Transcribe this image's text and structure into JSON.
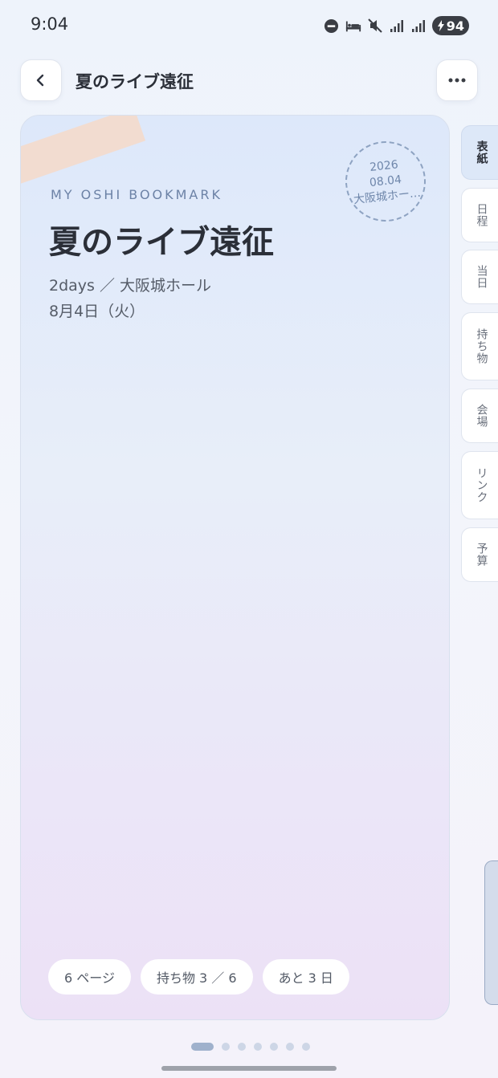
{
  "status_bar": {
    "time": "9:04",
    "battery": "94",
    "icons": [
      "do-not-disturb-icon",
      "bed-icon",
      "mute-icon",
      "signal-icon",
      "signal-icon",
      "battery-charging-icon"
    ]
  },
  "header": {
    "title": "夏のライブ遠征",
    "back_icon": "chevron-left-icon",
    "more_icon": "more-horizontal-icon"
  },
  "cover": {
    "kicker": "MY OSHI BOOKMARK",
    "title": "夏のライブ遠征",
    "subtitle": "2days ／ 大阪城ホール",
    "date": "8月4日（火）",
    "stamp": {
      "year": "2026",
      "date": "08.04",
      "venue": "大阪城ホー…"
    },
    "chips": [
      "6 ページ",
      "持ち物 3 ／ 6",
      "あと 3 日"
    ]
  },
  "tabs": [
    {
      "label": "表紙",
      "active": true
    },
    {
      "label": "日程",
      "active": false
    },
    {
      "label": "当日",
      "active": false
    },
    {
      "label": "持ち物",
      "active": false
    },
    {
      "label": "会場",
      "active": false
    },
    {
      "label": "リンク",
      "active": false
    },
    {
      "label": "予算",
      "active": false
    }
  ],
  "pager": {
    "current": 1,
    "total": 7
  },
  "colors": {
    "accent": "#9fb1cc",
    "tab_active": "#dde8f8",
    "tape": "#f6d9c8",
    "stamp": "#8ea3c2"
  }
}
